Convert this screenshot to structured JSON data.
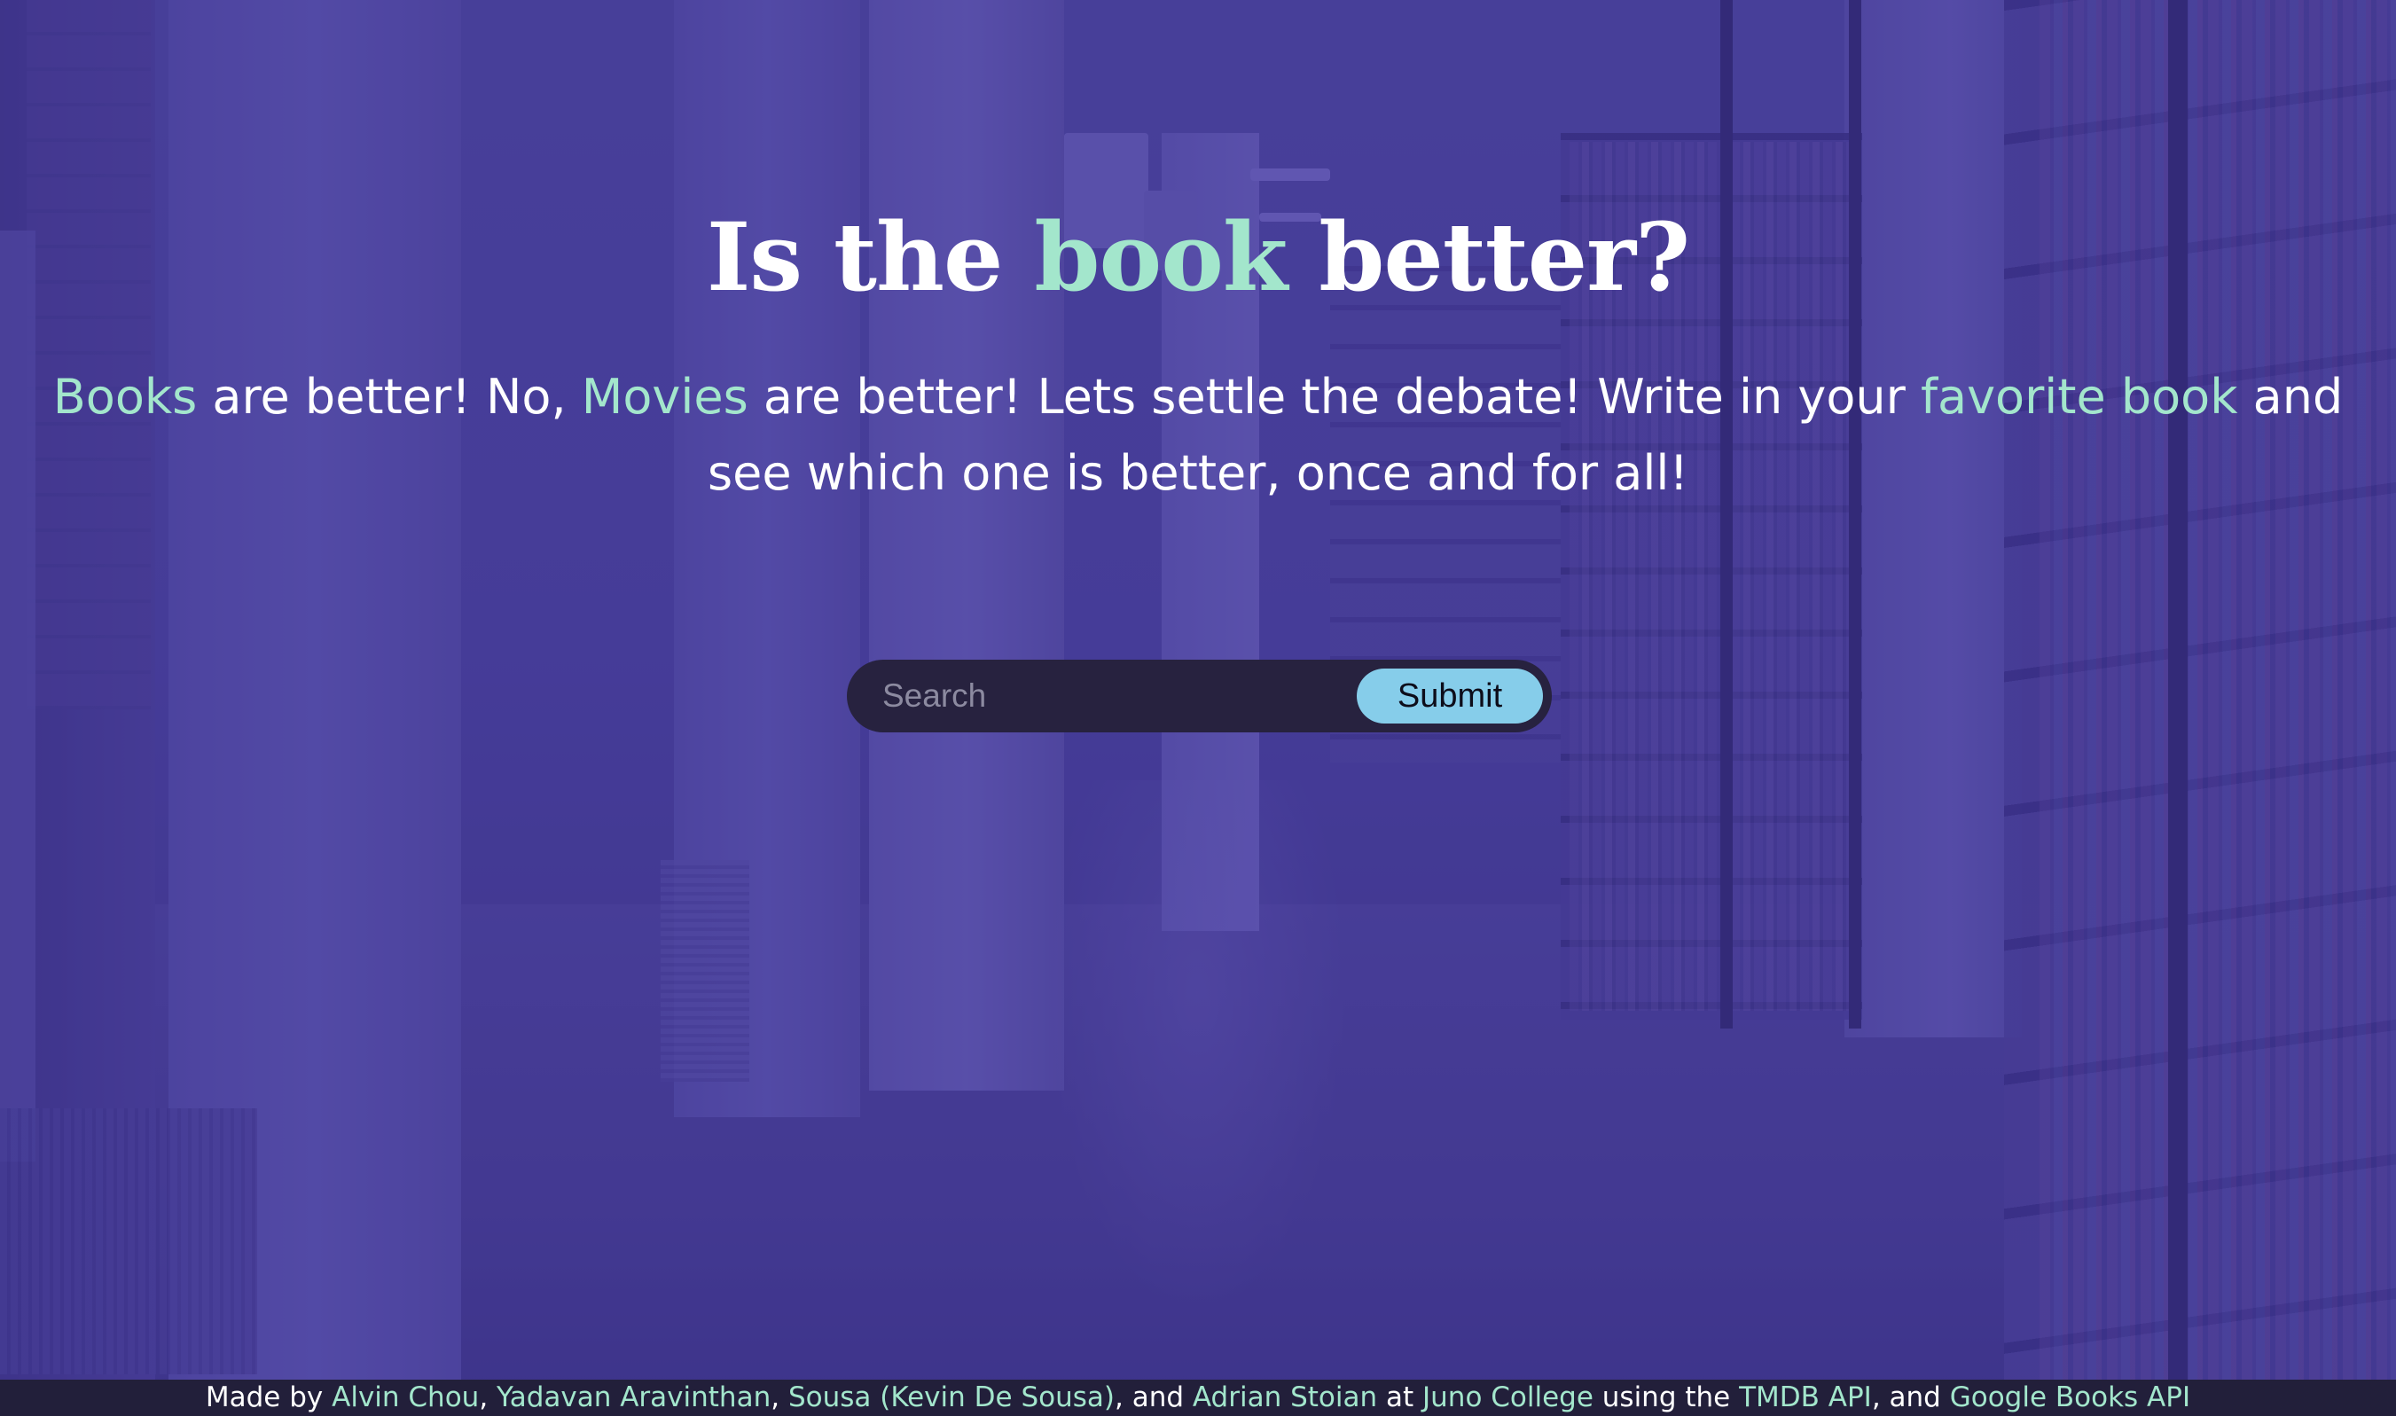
{
  "title": {
    "before": "Is the ",
    "accent": "book",
    "after": " better?"
  },
  "tagline": {
    "part1_accent": "Books",
    "part2": " are better! No, ",
    "part3_accent": "Movies",
    "part4": " are better! Lets settle the debate! Write in your ",
    "part5_accent": "favorite book",
    "part6": " and see which one is better, once and for all!"
  },
  "search": {
    "placeholder": "Search",
    "value": "",
    "submit_label": "Submit"
  },
  "footer": {
    "made_by": "Made by ",
    "author1": "Alvin Chou",
    "sep1": ", ",
    "author2": "Yadavan Aravinthan",
    "sep2": ", ",
    "author3": "Sousa (Kevin De Sousa)",
    "sep3": ", and ",
    "author4": "Adrian Stoian",
    "at": " at ",
    "school": "Juno College",
    "using": " using the ",
    "api1": "TMDB API",
    "and": ", and ",
    "api2": "Google Books API"
  },
  "colors": {
    "accent": "#a3e6cc",
    "overlay": "#4034967a",
    "search_bg": "#27223f",
    "button_bg": "#86cdea",
    "footer_bg": "#221f3a"
  }
}
